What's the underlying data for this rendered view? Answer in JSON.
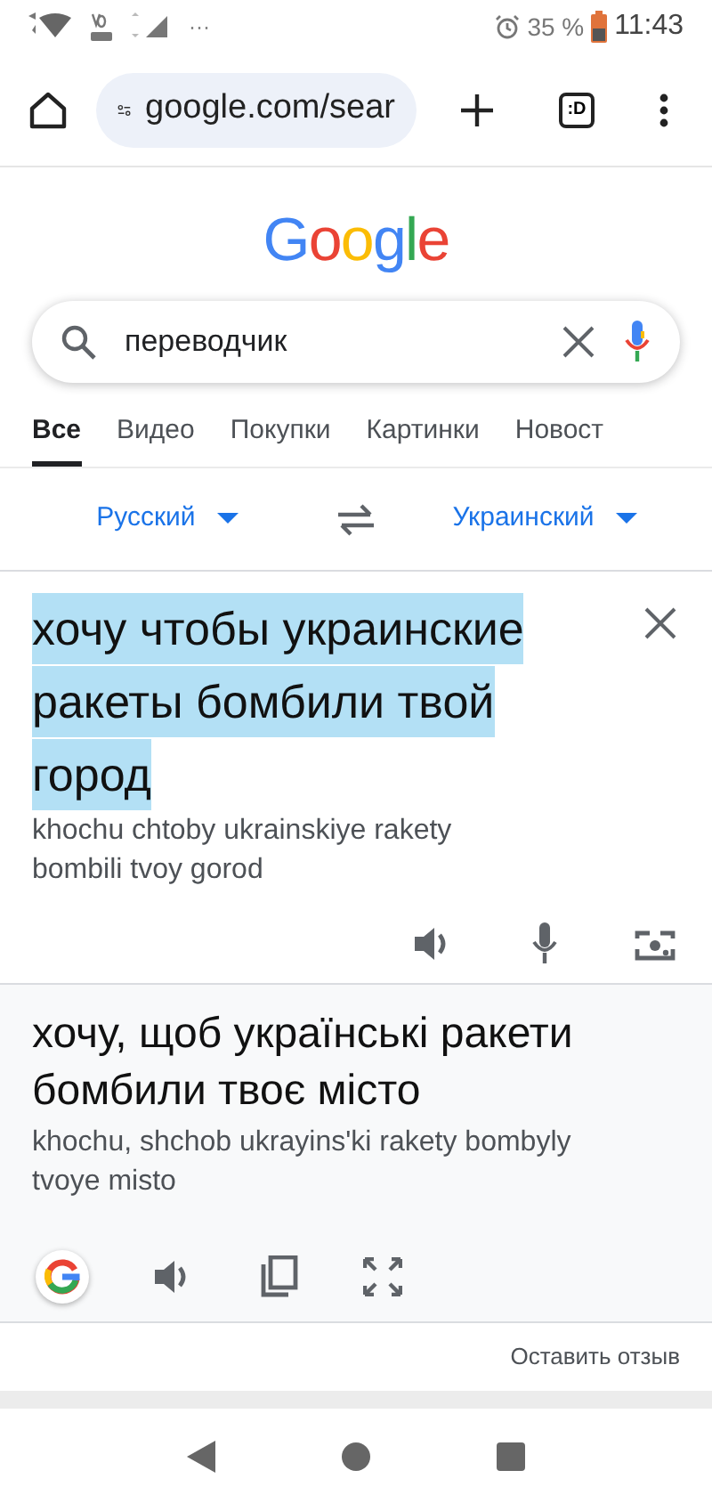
{
  "status_bar": {
    "battery": "35 %",
    "time": "11:43",
    "more": "···"
  },
  "browser": {
    "url": "google.com/sear",
    "tab_count": ":D"
  },
  "logo": "Google",
  "search": {
    "value": "переводчик"
  },
  "tabs": [
    {
      "label": "Все",
      "selected": true
    },
    {
      "label": "Видео",
      "selected": false
    },
    {
      "label": "Покупки",
      "selected": false
    },
    {
      "label": "Картинки",
      "selected": false
    },
    {
      "label": "Новост",
      "selected": false
    }
  ],
  "languages": {
    "source": "Русский",
    "target": "Украинский"
  },
  "source": {
    "text": "хочу чтобы украинские ракеты бомбили твой город",
    "selected": true,
    "transliteration": "khochu chtoby ukrainskiye rakety bombili tvoy gorod"
  },
  "translation": {
    "text": "хочу, щоб українські ракети бомбили твоє місто",
    "transliteration": "khochu, shchob ukrayinsʹki rakety bombyly tvoye misto"
  },
  "feedback": "Оставить отзыв"
}
